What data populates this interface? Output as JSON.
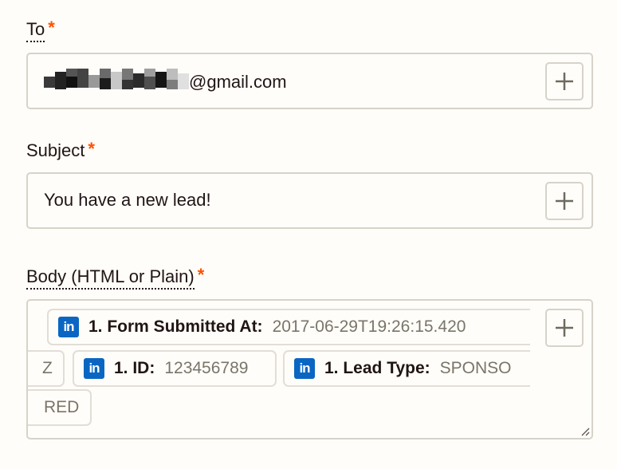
{
  "to": {
    "label": "To",
    "required": "*",
    "value_suffix": "@gmail.com"
  },
  "subject": {
    "label": "Subject",
    "required": "*",
    "value": "You have a new lead!"
  },
  "body": {
    "label": "Body (HTML or Plain)",
    "required": "*",
    "tokens": [
      {
        "icon": "linkedin-icon",
        "icon_text": "in",
        "name": "1. Form Submitted At:",
        "value": "2017-06-29T19:26:15.420"
      },
      {
        "continuation": "Z"
      },
      {
        "icon": "linkedin-icon",
        "icon_text": "in",
        "name": "1. ID:",
        "value": "123456789"
      },
      {
        "icon": "linkedin-icon",
        "icon_text": "in",
        "name": "1. Lead Type:",
        "value": "SPONSO"
      },
      {
        "continuation": "RED"
      }
    ]
  },
  "colors": {
    "required": "#ff4f00",
    "linkedin": "#0a66c2",
    "border": "#d7d3c9",
    "token_value": "#7a7569"
  }
}
